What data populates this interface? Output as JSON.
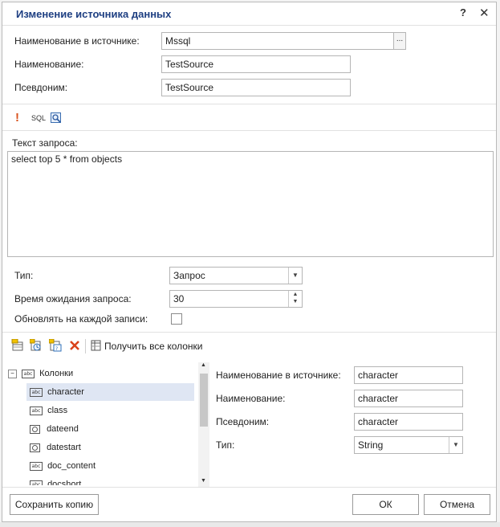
{
  "dialog": {
    "title": "Изменение источника данных",
    "help": "?",
    "close": "✕"
  },
  "fields": {
    "source_name_label": "Наименование в источнике:",
    "source_name_value": "Mssql",
    "browse_label": "...",
    "name_label": "Наименование:",
    "name_value": "TestSource",
    "alias_label": "Псевдоним:",
    "alias_value": "TestSource"
  },
  "query_toolbar": {
    "exclamation_icon": "!",
    "sql_label": "SQL"
  },
  "query": {
    "label": "Текст запроса:",
    "text": "select top 5 * from objects"
  },
  "settings": {
    "type_label": "Тип:",
    "type_value": "Запрос",
    "timeout_label": "Время ожидания запроса:",
    "timeout_value": "30",
    "refresh_label": "Обновлять на каждой записи:",
    "refresh_checked": false
  },
  "columns_toolbar": {
    "get_all_label": "Получить все колонки"
  },
  "tree": {
    "root_label": "Колонки",
    "items": [
      {
        "label": "character",
        "icon": "abc-icon",
        "selected": true
      },
      {
        "label": "class",
        "icon": "abc-icon",
        "selected": false
      },
      {
        "label": "dateend",
        "icon": "clock-icon",
        "selected": false
      },
      {
        "label": "datestart",
        "icon": "clock-icon",
        "selected": false
      },
      {
        "label": "doc_content",
        "icon": "abc-icon",
        "selected": false
      },
      {
        "label": "docshort",
        "icon": "abc-icon",
        "selected": false
      }
    ]
  },
  "column_details": {
    "source_name_label": "Наименование в источнике:",
    "source_name_value": "character",
    "name_label": "Наименование:",
    "name_value": "character",
    "alias_label": "Псевдоним:",
    "alias_value": "character",
    "type_label": "Тип:",
    "type_value": "String"
  },
  "buttons": {
    "save_copy": "Сохранить копию",
    "ok": "ОК",
    "cancel": "Отмена"
  },
  "colors": {
    "title": "#1e3f82",
    "selection": "#dfe6f3",
    "delete_icon": "#d9421b",
    "exclamation": "#d9531e"
  }
}
